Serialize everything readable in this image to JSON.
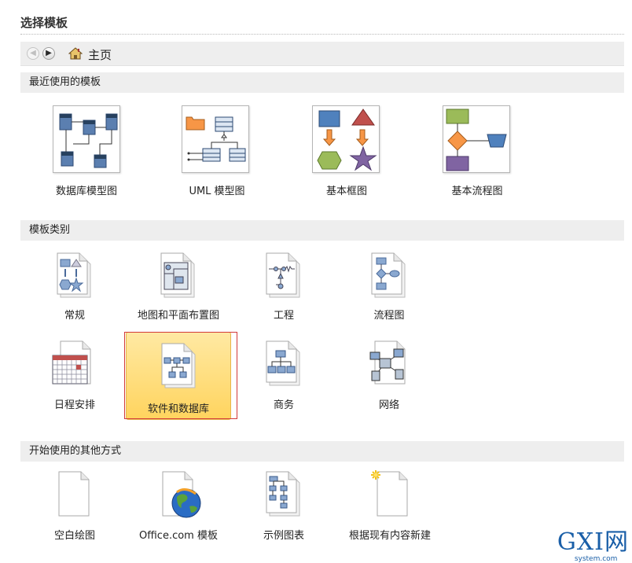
{
  "title": "选择模板",
  "nav": {
    "home_label": "主页"
  },
  "sections": {
    "recent": {
      "header": "最近使用的模板",
      "items": [
        "数据库模型图",
        "UML 模型图",
        "基本框图",
        "基本流程图"
      ]
    },
    "categories": {
      "header": "模板类别",
      "items": [
        "常规",
        "地图和平面布置图",
        "工程",
        "流程图",
        "日程安排",
        "软件和数据库",
        "商务",
        "网络"
      ],
      "selected": "软件和数据库"
    },
    "other": {
      "header": "开始使用的其他方式",
      "items": [
        "空白绘图",
        "Office.com 模板",
        "示例图表",
        "根据现有内容新建"
      ]
    }
  },
  "watermark": {
    "text": "GXI网",
    "sub": "system.com"
  },
  "colors": {
    "selection_fill": "#ffd45e",
    "selection_border": "#d23a3a",
    "shape_blue": "#4f81bd",
    "shape_red": "#c0504d",
    "shape_green": "#9bbb59",
    "shape_purple": "#8064a2",
    "shape_orange": "#f79646"
  }
}
